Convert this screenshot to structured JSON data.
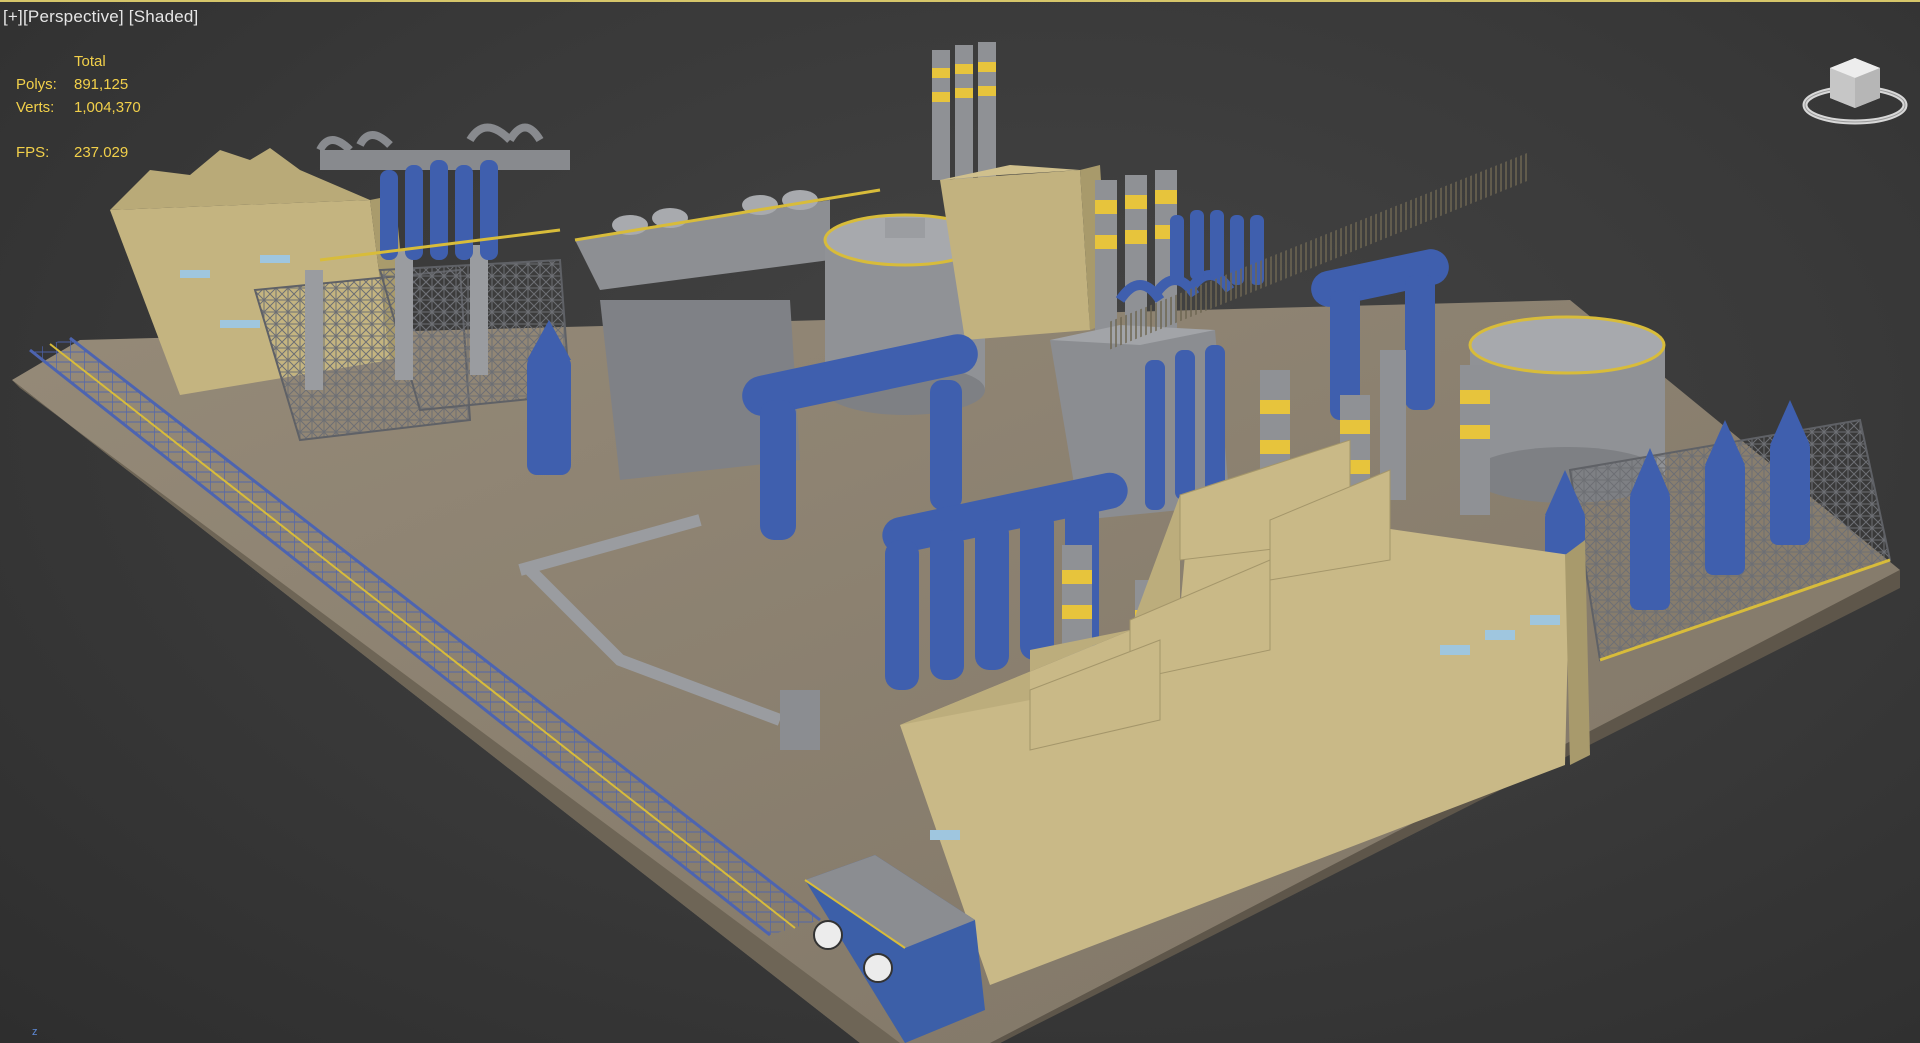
{
  "viewport": {
    "label_plus": "[+]",
    "label_view": "[Perspective]",
    "label_shading": "[Shaded]"
  },
  "stats": {
    "header": "Total",
    "polys_label": "Polys:",
    "polys_value": "891,125",
    "verts_label": "Verts:",
    "verts_value": "1,004,370",
    "fps_label": "FPS:",
    "fps_value": "237.029"
  },
  "axis_indicator": "z",
  "colors": {
    "background": "#393939",
    "stats_text": "#f2d04a",
    "label_text": "#e6e6e6",
    "ground": "#8f8474",
    "building": "#c9b987",
    "steel": "#8d8f93",
    "vessel_blue": "#3f5fae",
    "accent_yellow": "#e7c43c",
    "active_border": "#d6c66a"
  },
  "icons": {
    "viewcube": "viewcube-icon",
    "axis": "axis-tripod-icon"
  }
}
